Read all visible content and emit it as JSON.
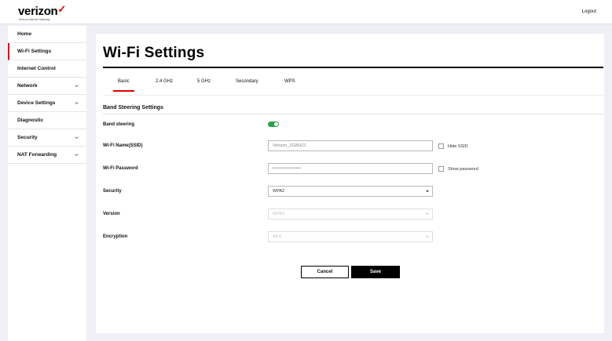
{
  "header": {
    "logo_text": "verizon",
    "logo_subtext": "Verizon Internet Gateway",
    "logout_label": "Logout",
    "accent_color": "#e00000"
  },
  "sidebar": {
    "items": [
      {
        "label": "Home",
        "has_submenu": false
      },
      {
        "label": "Wi-Fi Settings",
        "has_submenu": false,
        "active": true
      },
      {
        "label": "Internet Control",
        "has_submenu": false
      },
      {
        "label": "Network",
        "has_submenu": true
      },
      {
        "label": "Device Settings",
        "has_submenu": true
      },
      {
        "label": "Diagnostic",
        "has_submenu": false
      },
      {
        "label": "Security",
        "has_submenu": true
      },
      {
        "label": "NAT Forwarding",
        "has_submenu": true
      }
    ]
  },
  "main": {
    "title": "Wi-Fi Settings",
    "tabs": [
      {
        "label": "Basic",
        "active": true
      },
      {
        "label": "2.4 GHz"
      },
      {
        "label": "5 GHz"
      },
      {
        "label": "Secondary"
      },
      {
        "label": "WPS"
      }
    ],
    "section_title": "Band Steering Settings",
    "band_steering": {
      "label": "Band steering",
      "enabled": true
    },
    "ssid": {
      "label": "Wi-Fi Name(SSID)",
      "value": "Verizon_ZG8H22",
      "hide_label": "Hide SSID",
      "hide_checked": false
    },
    "password": {
      "label": "Wi-Fi Password",
      "value": "•••••••••••••••",
      "show_label": "Show password",
      "show_checked": false
    },
    "security": {
      "label": "Security",
      "value": "WPA2"
    },
    "version": {
      "label": "Version",
      "value": "WPA2",
      "disabled": true
    },
    "encryption": {
      "label": "Encryption",
      "value": "AES",
      "disabled": true
    },
    "cancel_label": "Cancel",
    "save_label": "Save"
  }
}
